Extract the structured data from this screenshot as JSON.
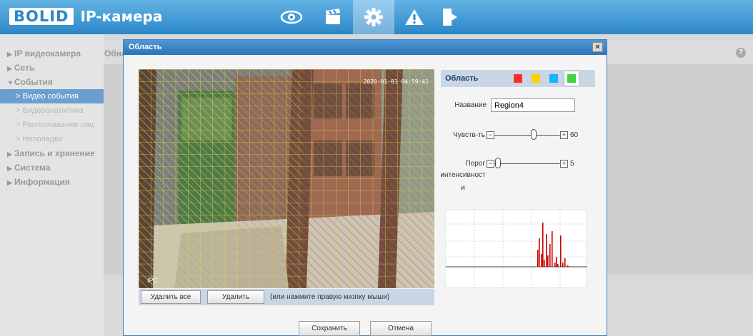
{
  "header": {
    "logo": "BOLID",
    "app_title": "IP-камера",
    "nav": [
      {
        "icon": "eye-icon"
      },
      {
        "icon": "clapperboard-icon"
      },
      {
        "icon": "gear-icon",
        "active": true
      },
      {
        "icon": "warning-icon"
      },
      {
        "icon": "logout-icon"
      }
    ]
  },
  "sidebar": {
    "items": [
      {
        "label": "IP видеокамера"
      },
      {
        "label": "Сеть"
      },
      {
        "label": "События",
        "expanded": true
      },
      {
        "label": "Запись и хранение"
      },
      {
        "label": "Система"
      },
      {
        "label": "Информация"
      }
    ],
    "sub_items": [
      {
        "label": "Видео события",
        "active": true
      },
      {
        "label": "Видеоаналитика"
      },
      {
        "label": "Распознавание лиц"
      },
      {
        "label": "Неполадки"
      }
    ]
  },
  "content": {
    "tab_label": "Обна"
  },
  "modal": {
    "title": "Область",
    "close": "×",
    "camera": {
      "timestamp": "2020-01-01 04:59:41",
      "channel_label": "IPC"
    },
    "toolbar": {
      "delete_all": "Удалить все",
      "delete": "Удалить",
      "hint": "(или нажмите правую кнопку мыши)"
    },
    "region_panel": {
      "title": "Область",
      "colors": [
        "#ff2a2a",
        "#ffd000",
        "#14b4ff",
        "#3fd43f"
      ],
      "selected_color_index": 3
    },
    "name_label": "Название",
    "name_value": "Region4",
    "sensitivity": {
      "label": "Чувств-ть",
      "value": "60",
      "level": 0.6
    },
    "threshold": {
      "label_line1": "Порог",
      "label_line2": "интенсивност",
      "label_line3": "и",
      "value": "5",
      "level": 0.05
    },
    "graph_color": "#cc0000",
    "save": "Сохранить",
    "cancel": "Отмена"
  }
}
